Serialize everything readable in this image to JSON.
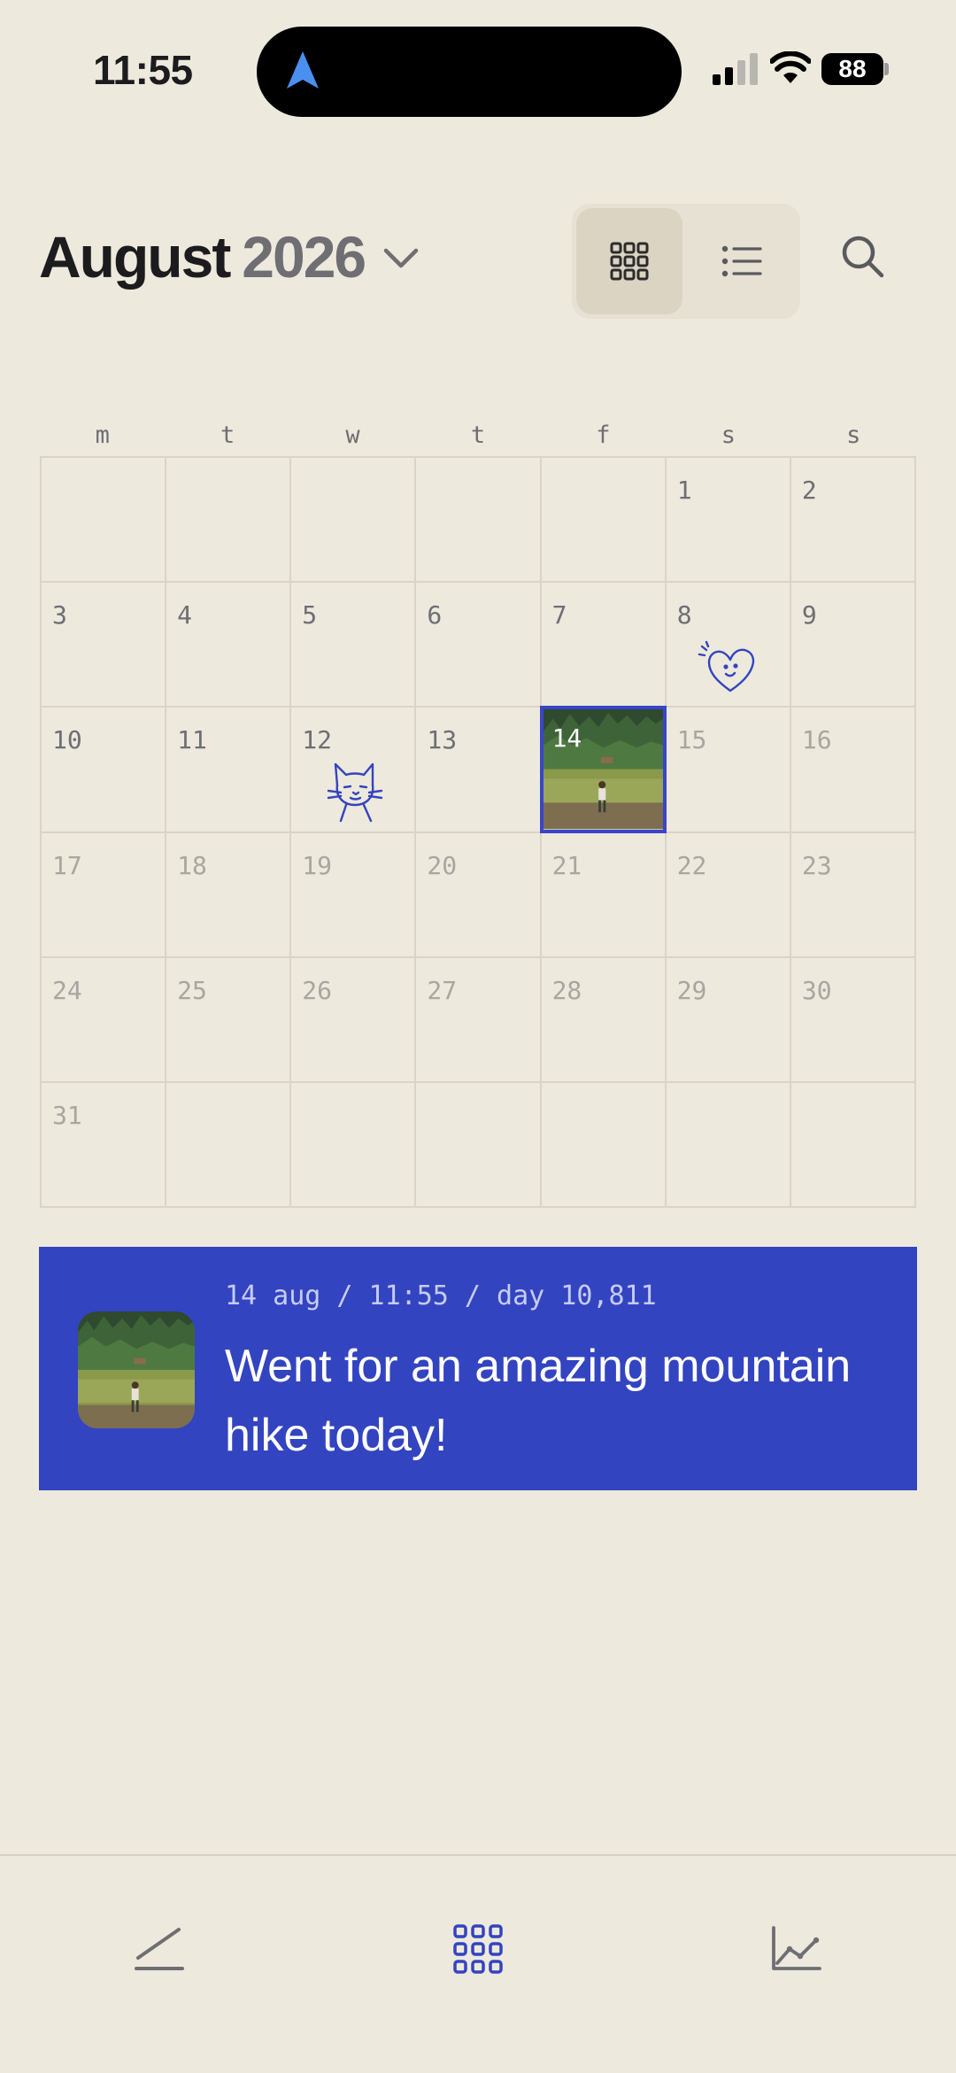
{
  "status_bar": {
    "time": "11:55",
    "battery": "88"
  },
  "header": {
    "month": "August",
    "year": "2026"
  },
  "calendar": {
    "weekdays": [
      "m",
      "t",
      "w",
      "t",
      "f",
      "s",
      "s"
    ],
    "selected_day": "14",
    "accent_color": "#3344c0",
    "days": {
      "d1": "1",
      "d2": "2",
      "d3": "3",
      "d4": "4",
      "d5": "5",
      "d6": "6",
      "d7": "7",
      "d8": "8",
      "d9": "9",
      "d10": "10",
      "d11": "11",
      "d12": "12",
      "d13": "13",
      "d14": "14",
      "d15": "15",
      "d16": "16",
      "d17": "17",
      "d18": "18",
      "d19": "19",
      "d20": "20",
      "d21": "21",
      "d22": "22",
      "d23": "23",
      "d24": "24",
      "d25": "25",
      "d26": "26",
      "d27": "27",
      "d28": "28",
      "d29": "29",
      "d30": "30",
      "d31": "31"
    },
    "stickers": {
      "d8": "heart-doodle",
      "d12": "cat-doodle"
    }
  },
  "entry": {
    "meta": "14 aug / 11:55 / day 10,811",
    "text": "Went for an amazing mountain hike today!"
  },
  "tab_bar": {
    "items": [
      "write-icon",
      "calendar-grid-icon",
      "stats-chart-icon"
    ],
    "active": "calendar-grid-icon"
  }
}
